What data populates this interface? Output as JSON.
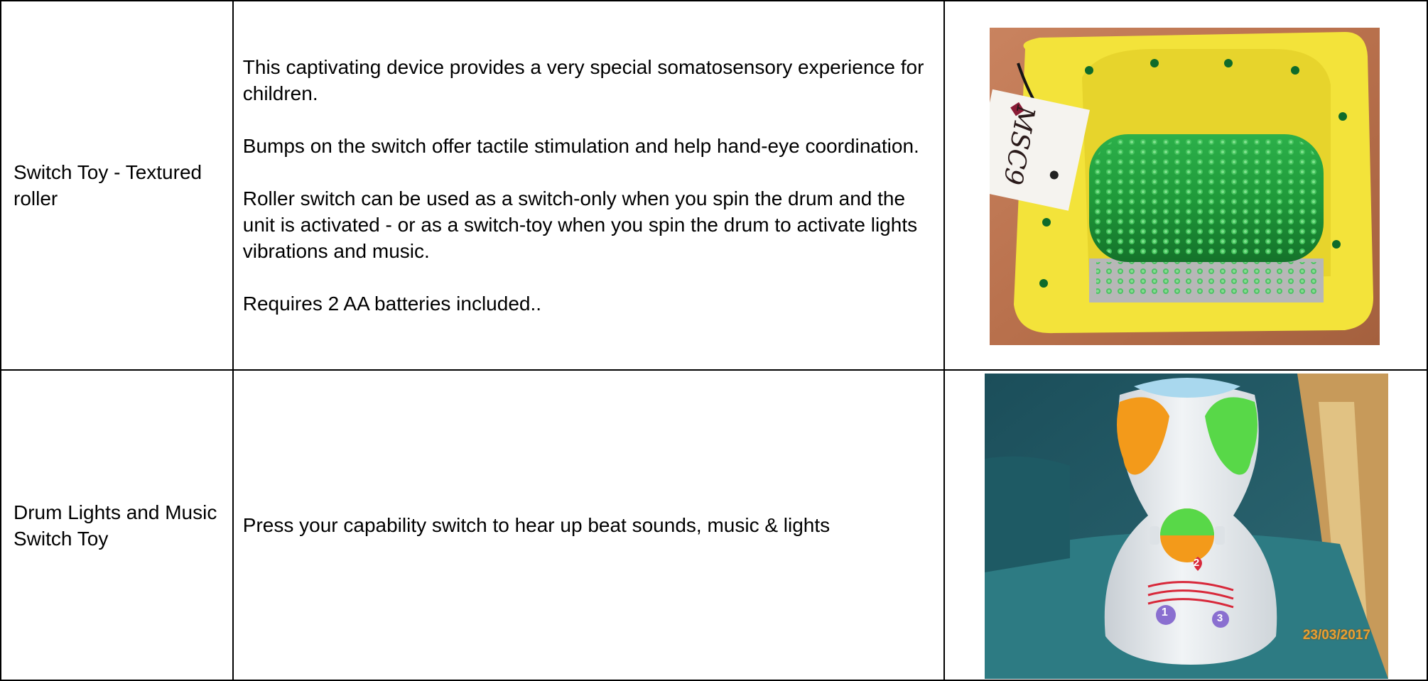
{
  "rows": [
    {
      "name": "Switch Toy - Textured roller",
      "paragraphs": [
        "This captivating device provides a very special somatosensory experience for children.",
        "Bumps on the switch offer tactile stimulation and help hand-eye coordination.",
        "Roller switch can be used as a switch-only when you spin the drum and the unit is activated - or as a switch-toy when you spin the drum to activate lights vibrations and music.",
        "Requires 2 AA batteries included.."
      ],
      "photo": {
        "subject": "textured-roller-switch-icon",
        "tag_text": "MSC9"
      }
    },
    {
      "name": "Drum Lights and Music Switch Toy",
      "paragraphs": [
        "Press your capability switch to hear up beat sounds, music & lights"
      ],
      "photo": {
        "subject": "drum-switch-toy-icon",
        "badge_numbers": [
          "1",
          "2",
          "3"
        ],
        "date_stamp": "23/03/2017"
      }
    }
  ],
  "colors": {
    "border": "#000000",
    "roller_base": "#f3e33a",
    "roller_drum": "#1f9a3a",
    "toy_body": "#e9eef2",
    "toy_orange": "#f39a1a",
    "toy_green": "#58d848",
    "toy_purple": "#8a6fd0",
    "toy_red": "#d8283a",
    "stamp": "#e8a033"
  }
}
